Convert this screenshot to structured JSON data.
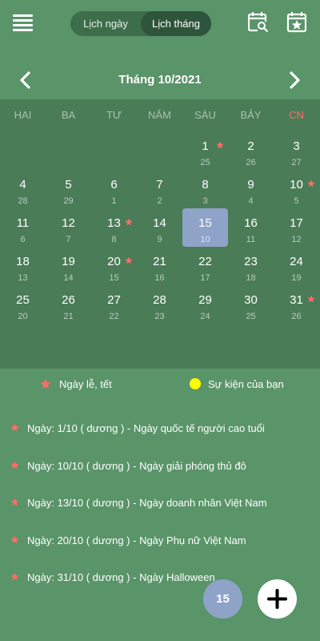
{
  "header": {
    "tabs": [
      "Lịch ngày",
      "Lịch tháng"
    ],
    "active_tab": "Lịch tháng",
    "icons": [
      "menu-icon",
      "calendar-search-icon",
      "calendar-star-icon"
    ]
  },
  "month_title": "Tháng 10/2021",
  "weekdays": [
    "HAI",
    "BA",
    "TƯ",
    "NĂM",
    "SÁU",
    "BẢY",
    "CN"
  ],
  "colors": {
    "background": "#5a9469",
    "grid": "#4a7c57",
    "today_highlight": "#8fa3c9",
    "holiday_star": "#ff6b6b",
    "event_dot": "#ffff00",
    "sunday_header": "#ff6b6b"
  },
  "weeks": [
    [
      null,
      null,
      null,
      null,
      {
        "solar": "1",
        "lunar": "25",
        "holiday": true
      },
      {
        "solar": "2",
        "lunar": "26"
      },
      {
        "solar": "3",
        "lunar": "27"
      }
    ],
    [
      {
        "solar": "4",
        "lunar": "28"
      },
      {
        "solar": "5",
        "lunar": "29"
      },
      {
        "solar": "6",
        "lunar": "1"
      },
      {
        "solar": "7",
        "lunar": "2"
      },
      {
        "solar": "8",
        "lunar": "3"
      },
      {
        "solar": "9",
        "lunar": "4"
      },
      {
        "solar": "10",
        "lunar": "5",
        "holiday": true
      }
    ],
    [
      {
        "solar": "11",
        "lunar": "6"
      },
      {
        "solar": "12",
        "lunar": "7"
      },
      {
        "solar": "13",
        "lunar": "8",
        "holiday": true
      },
      {
        "solar": "14",
        "lunar": "9"
      },
      {
        "solar": "15",
        "lunar": "10",
        "today": true
      },
      {
        "solar": "16",
        "lunar": "11"
      },
      {
        "solar": "17",
        "lunar": "12"
      }
    ],
    [
      {
        "solar": "18",
        "lunar": "13"
      },
      {
        "solar": "19",
        "lunar": "14"
      },
      {
        "solar": "20",
        "lunar": "15",
        "holiday": true
      },
      {
        "solar": "21",
        "lunar": "16"
      },
      {
        "solar": "22",
        "lunar": "17"
      },
      {
        "solar": "23",
        "lunar": "18"
      },
      {
        "solar": "24",
        "lunar": "19"
      }
    ],
    [
      {
        "solar": "25",
        "lunar": "20"
      },
      {
        "solar": "26",
        "lunar": "21"
      },
      {
        "solar": "27",
        "lunar": "22"
      },
      {
        "solar": "28",
        "lunar": "23"
      },
      {
        "solar": "29",
        "lunar": "24"
      },
      {
        "solar": "30",
        "lunar": "25"
      },
      {
        "solar": "31",
        "lunar": "26",
        "holiday": true
      }
    ]
  ],
  "legend": {
    "holiday": "Ngày lễ, tết",
    "event": "Sự kiện của bạn"
  },
  "holidays": [
    "Ngày: 1/10 ( dương ) - Ngày quốc tế người cao tuổi",
    "Ngày: 10/10 ( dương ) - Ngày giải phóng thủ đô",
    "Ngày: 13/10 ( dương ) - Ngày doanh nhân Việt Nam",
    "Ngày: 20/10 ( dương ) - Ngày Phụ nữ Việt Nam",
    "Ngày: 31/10 ( dương ) - Ngày Halloween"
  ],
  "today_button": "15"
}
